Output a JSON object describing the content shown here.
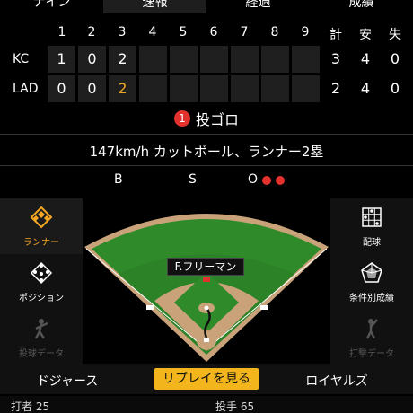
{
  "tabs": [
    {
      "label": "ナイン"
    },
    {
      "label": "速報"
    },
    {
      "label": "経過"
    },
    {
      "label": "成績"
    }
  ],
  "scoreboard": {
    "innings": [
      "1",
      "2",
      "3",
      "4",
      "5",
      "6",
      "7",
      "8",
      "9"
    ],
    "totals_headers": [
      "計",
      "安",
      "失"
    ],
    "rows": [
      {
        "team": "KC",
        "scores": [
          "1",
          "0",
          "2",
          "",
          "",
          "",
          "",
          "",
          ""
        ],
        "totals": [
          "3",
          "4",
          "0"
        ]
      },
      {
        "team": "LAD",
        "scores": [
          "0",
          "0",
          "2",
          "",
          "",
          "",
          "",
          "",
          ""
        ],
        "totals": [
          "2",
          "4",
          "0"
        ]
      }
    ],
    "highlight_color": "#f5a623"
  },
  "play": {
    "badge": "1",
    "result": "投ゴロ",
    "pitch_info": "147km/h カットボール、ランナー2塁"
  },
  "count": {
    "balls_label": "B",
    "strikes_label": "S",
    "outs_label": "O",
    "balls": 0,
    "strikes": 0,
    "outs": 2,
    "out_color": "#e3322e"
  },
  "left_menu": [
    {
      "label": "ランナー",
      "icon": "runner-diamond-icon",
      "active": true
    },
    {
      "label": "ポジション",
      "icon": "position-icon",
      "active": false
    },
    {
      "label": "投球データ",
      "icon": "pitcher-icon",
      "active": false
    }
  ],
  "right_menu": [
    {
      "label": "配球",
      "icon": "pitch-grid-icon"
    },
    {
      "label": "条件別成績",
      "icon": "radar-chart-icon"
    },
    {
      "label": "打撃データ",
      "icon": "batter-icon"
    }
  ],
  "field": {
    "player_label": "F.フリーマン"
  },
  "bottom_bar": {
    "home_team": "ドジャース",
    "replay_label": "リプレイを見る",
    "away_team": "ロイヤルズ"
  },
  "footer": {
    "batter": "打者 25",
    "pitcher": "投手 65"
  }
}
